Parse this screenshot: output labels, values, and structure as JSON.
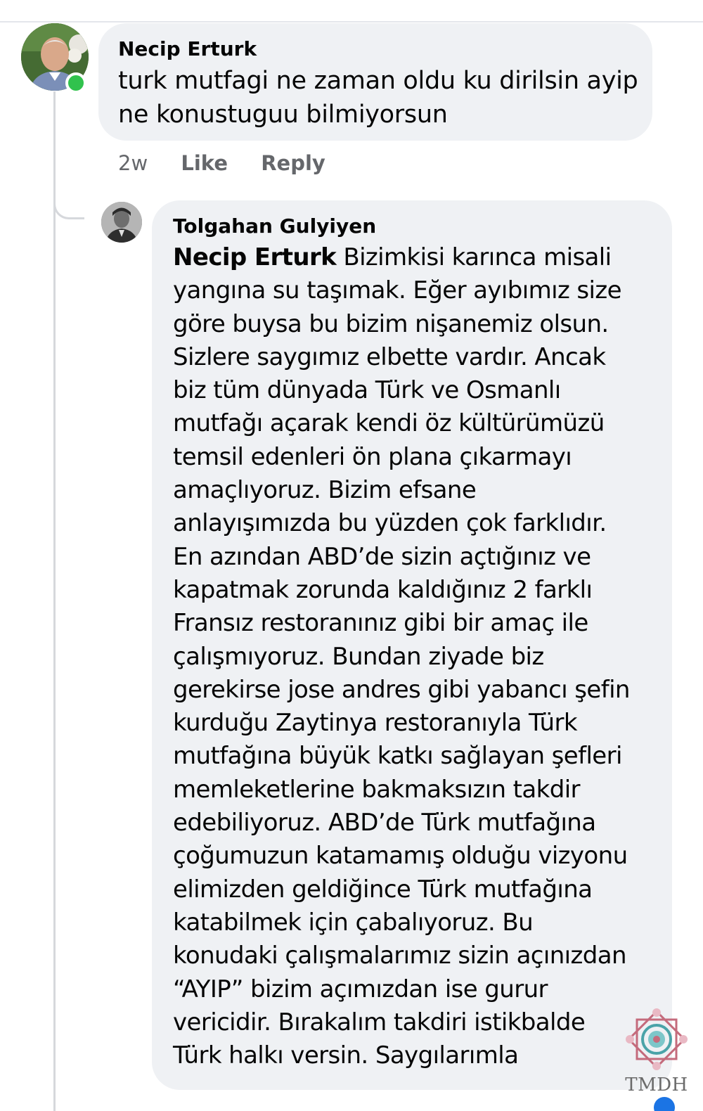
{
  "comments": [
    {
      "author": "Necip Erturk",
      "text_lines": [
        "turk mutfagi ne zaman oldu ku dirilsin ayip",
        "ne konustuguu bilmiyorsun"
      ],
      "time": "2w",
      "like_label": "Like",
      "reply_label": "Reply",
      "online": true
    }
  ],
  "reply": {
    "author": "Tolgahan Gulyiyen",
    "mention": "Necip Erturk",
    "first_line_rest": " Bizimkisi karınca misali",
    "text_lines": [
      "yangına su taşımak. Eğer ayıbımız size",
      "göre buysa bu bizim nişanemiz olsun.",
      "Sizlere saygımız elbette vardır. Ancak",
      "biz tüm dünyada Türk ve Osmanlı",
      "mutfağı açarak kendi öz kültürümüzü",
      "temsil edenleri ön plana çıkarmayı",
      "amaçlıyoruz. Bizim efsane",
      "anlayışımızda bu yüzden çok farklıdır.",
      "En azından ABD’de sizin açtığınız ve",
      "kapatmak zorunda kaldığınız 2 farklı",
      "Fransız restoranınız gibi bir amaç ile",
      "çalışmıyoruz. Bundan ziyade biz",
      "gerekirse jose andres gibi yabancı şefin",
      "kurduğu Zaytinya restoranıyla Türk",
      "mutfağına büyük katkı sağlayan şefleri",
      "memleketlerine bakmaksızın takdir",
      "edebiliyoruz. ABD’de Türk mutfağına",
      "çoğumuzun katamamış olduğu vizyonu",
      "elimizden geldiğince Türk mutfağına",
      "katabilmek için çabalıyoruz. Bu",
      "konudaki çalışmalarımız sizin açınızdan",
      "“AYIP” bizim açımızdan ise gurur",
      "vericidir. Bırakalım takdiri istikbalde",
      "Türk halkı versin. Saygılarımla"
    ]
  },
  "watermark": {
    "text": "TMDH"
  },
  "colors": {
    "bubble": "#eff1f4",
    "secondary_text": "#65676b",
    "online": "#31c24d",
    "thread_line": "#d6d8dc"
  }
}
